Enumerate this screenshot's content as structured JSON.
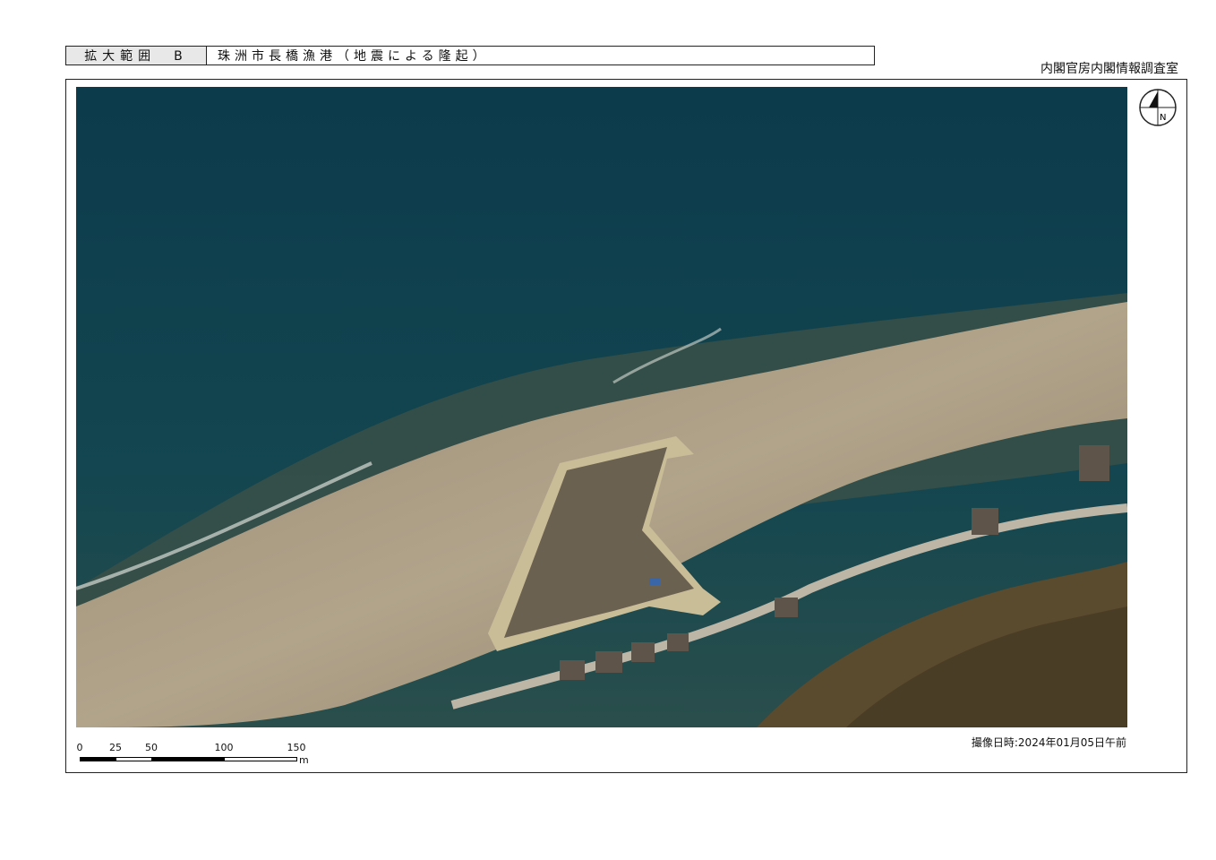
{
  "header": {
    "range_label": "拡大範囲　B",
    "title": "珠洲市長橋漁港（地震による隆起）"
  },
  "organization": "内閣官房内閣情報調査室",
  "capture_date": "撮像日時:2024年01月05日午前",
  "scale_bar": {
    "labels": [
      "0",
      "25",
      "50",
      "100",
      "150"
    ],
    "unit": "m"
  },
  "north_arrow": {
    "label": "N",
    "icon": "north-arrow-icon"
  },
  "colors": {
    "sea_deep": "#0d3a4a",
    "sea_shallow": "#2b4f4f",
    "shore_rock": "#a8977c",
    "land_forest": "#5a4a2e"
  }
}
